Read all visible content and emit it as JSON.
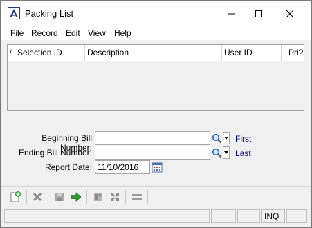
{
  "window": {
    "title": "Packing List"
  },
  "menu": {
    "items": [
      {
        "label": "File"
      },
      {
        "label": "Record"
      },
      {
        "label": "Edit"
      },
      {
        "label": "View"
      },
      {
        "label": "Help"
      }
    ]
  },
  "grid": {
    "sort_glyph": "/",
    "columns": [
      {
        "label": "Selection ID"
      },
      {
        "label": "Description"
      },
      {
        "label": "User ID"
      },
      {
        "label": "Pri?"
      }
    ],
    "rows": []
  },
  "form": {
    "beginning_bill_label": "Beginning Bill Number:",
    "beginning_bill_value": "",
    "beginning_bill_link": "First",
    "ending_bill_label": "Ending Bill Number:",
    "ending_bill_value": "",
    "ending_bill_link": "Last",
    "report_date_label": "Report Date:",
    "report_date_value": "11/10/2016"
  },
  "status": {
    "mode": "INQ"
  },
  "colors": {
    "link": "#00007f",
    "accent": "#1f3b8c",
    "go_arrow": "#2e9e2e"
  }
}
